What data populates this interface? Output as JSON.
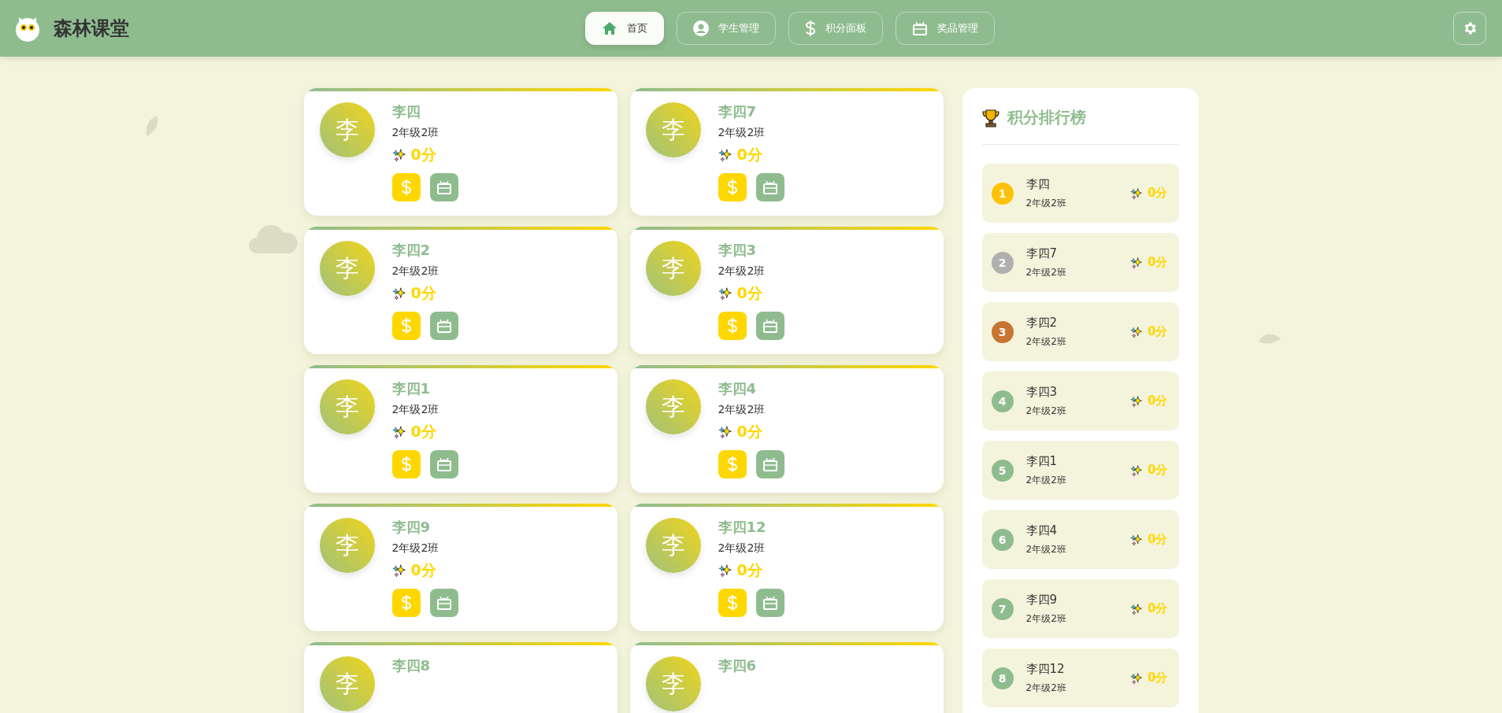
{
  "header": {
    "title": "森林课堂",
    "nav": [
      {
        "label": "首页",
        "selected": true
      },
      {
        "label": "学生管理",
        "selected": false
      },
      {
        "label": "积分面板",
        "selected": false
      },
      {
        "label": "奖品管理",
        "selected": false
      }
    ]
  },
  "students": [
    {
      "avatar": "李",
      "name": "李四",
      "class": "2年级2班",
      "score": "0分"
    },
    {
      "avatar": "李",
      "name": "李四7",
      "class": "2年级2班",
      "score": "0分"
    },
    {
      "avatar": "李",
      "name": "李四2",
      "class": "2年级2班",
      "score": "0分"
    },
    {
      "avatar": "李",
      "name": "李四3",
      "class": "2年级2班",
      "score": "0分"
    },
    {
      "avatar": "李",
      "name": "李四1",
      "class": "2年级2班",
      "score": "0分"
    },
    {
      "avatar": "李",
      "name": "李四4",
      "class": "2年级2班",
      "score": "0分"
    },
    {
      "avatar": "李",
      "name": "李四9",
      "class": "2年级2班",
      "score": "0分"
    },
    {
      "avatar": "李",
      "name": "李四12",
      "class": "2年级2班",
      "score": "0分"
    },
    {
      "avatar": "李",
      "name": "李四8"
    },
    {
      "avatar": "李",
      "name": "李四6"
    }
  ],
  "ranking": {
    "title": "积分排行榜",
    "items": [
      {
        "rank": "1",
        "color": "#ffc107",
        "name": "李四",
        "class": "2年级2班",
        "score": "0分"
      },
      {
        "rank": "2",
        "color": "#b0b0b0",
        "name": "李四7",
        "class": "2年级2班",
        "score": "0分"
      },
      {
        "rank": "3",
        "color": "#c87533",
        "name": "李四2",
        "class": "2年级2班",
        "score": "0分"
      },
      {
        "rank": "4",
        "color": "#8fbc8f",
        "name": "李四3",
        "class": "2年级2班",
        "score": "0分"
      },
      {
        "rank": "5",
        "color": "#8fbc8f",
        "name": "李四1",
        "class": "2年级2班",
        "score": "0分"
      },
      {
        "rank": "6",
        "color": "#8fbc8f",
        "name": "李四4",
        "class": "2年级2班",
        "score": "0分"
      },
      {
        "rank": "7",
        "color": "#8fbc8f",
        "name": "李四9",
        "class": "2年级2班",
        "score": "0分"
      },
      {
        "rank": "8",
        "color": "#8fbc8f",
        "name": "李四12",
        "class": "2年级2班",
        "score": "0分"
      }
    ]
  }
}
